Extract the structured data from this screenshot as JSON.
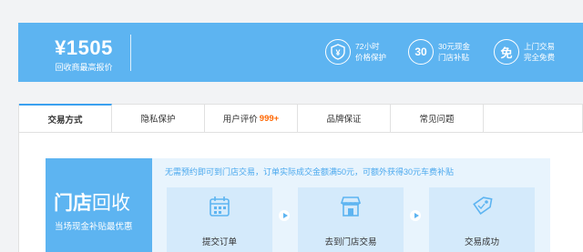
{
  "banner": {
    "price": "¥1505",
    "price_subtitle": "回收商最高报价",
    "perks": [
      {
        "icon": "shield-yen-icon",
        "glyph": "¥",
        "line1": "72小时",
        "line2": "价格保护"
      },
      {
        "icon": "thirty-badge-icon",
        "glyph": "30",
        "line1": "30元现金",
        "line2": "门店补贴"
      },
      {
        "icon": "free-badge-icon",
        "glyph": "免",
        "line1": "上门交易",
        "line2": "完全免费"
      }
    ]
  },
  "tabs": [
    {
      "label": "交易方式",
      "active": true
    },
    {
      "label": "隐私保护"
    },
    {
      "label": "用户评价",
      "badge": "999+"
    },
    {
      "label": "品牌保证"
    },
    {
      "label": "常见问题"
    }
  ],
  "store": {
    "title_bold": "门店",
    "title_rest": "回收",
    "subtitle": "当场现金补贴最优惠",
    "note": "无需预约即可到门店交易，订单实际成交金额满50元，可额外获得30元车费补贴",
    "steps": [
      {
        "icon": "calendar-icon",
        "label": "提交订单"
      },
      {
        "icon": "store-icon",
        "label": "去到门店交易"
      },
      {
        "icon": "tag-icon",
        "label": "交易成功"
      }
    ]
  },
  "colors": {
    "accent": "#5db4f1",
    "badge": "#ff6600",
    "flow_bg": "#e8f4fd"
  }
}
